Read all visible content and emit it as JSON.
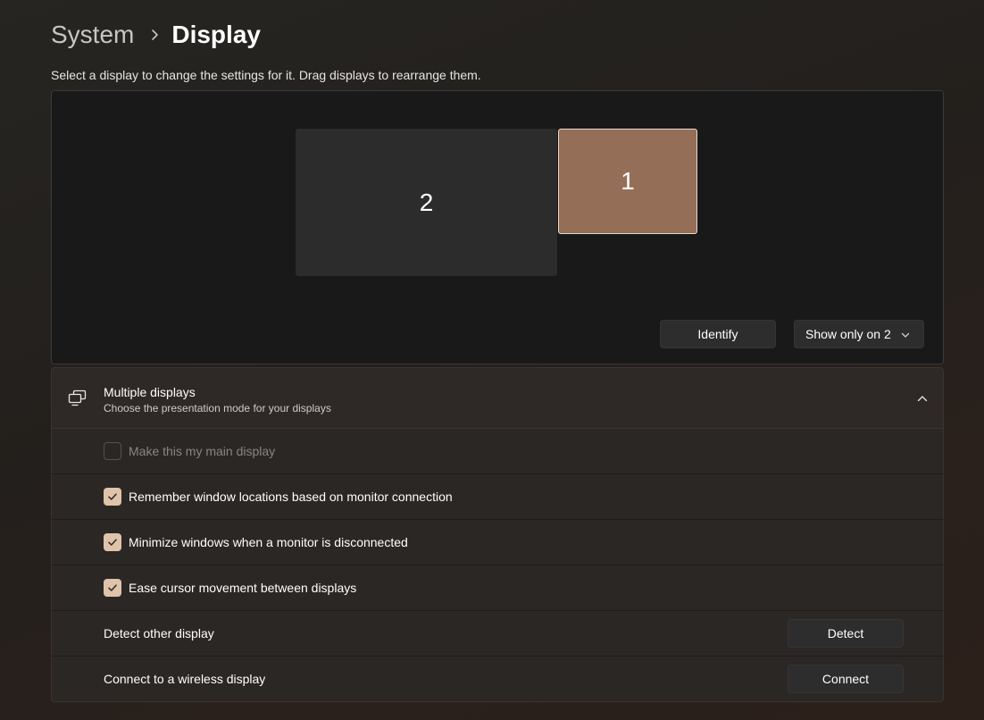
{
  "breadcrumb": {
    "parent": "System",
    "current": "Display"
  },
  "subtitle": "Select a display to change the settings for it. Drag displays to rearrange them.",
  "arrangement": {
    "monitors": [
      {
        "label": "2",
        "selected": false
      },
      {
        "label": "1",
        "selected": true
      }
    ],
    "identify_label": "Identify",
    "project_mode": "Show only on 2"
  },
  "multiple_displays": {
    "title": "Multiple displays",
    "description": "Choose the presentation mode for your displays",
    "expanded": true,
    "options": [
      {
        "label": "Make this my main display",
        "checked": false,
        "disabled": true
      },
      {
        "label": "Remember window locations based on monitor connection",
        "checked": true,
        "disabled": false
      },
      {
        "label": "Minimize windows when a monitor is disconnected",
        "checked": true,
        "disabled": false
      },
      {
        "label": "Ease cursor movement between displays",
        "checked": true,
        "disabled": false
      }
    ],
    "detect": {
      "label": "Detect other display",
      "button": "Detect"
    },
    "connect": {
      "label": "Connect to a wireless display",
      "button": "Connect"
    }
  },
  "colors": {
    "accent": "#dfc3aa",
    "selected_monitor": "#956e57"
  }
}
